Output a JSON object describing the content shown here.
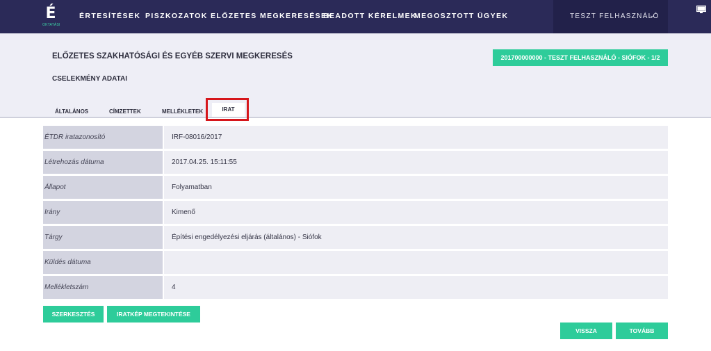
{
  "nav": {
    "logo_letter": "É",
    "logo_subtext": "OKTATÁSI",
    "items": [
      {
        "label": "Értesítések"
      },
      {
        "label": "Piszkozatok"
      },
      {
        "label": "Előzetes megkeresések"
      },
      {
        "label": "Beadott kérelmek"
      },
      {
        "label": "Megosztott ügyek"
      }
    ],
    "user_label": "TESZT FELHASZNÁLÓ",
    "user_caret": "⌄"
  },
  "header": {
    "title": "ELŐZETES SZAKHATÓSÁGI ÉS EGYÉB SZERVI MEGKERESÉS",
    "section": "CSELEKMÉNY ADATAI",
    "badge": "201700000000 - TESZT FELHASZNÁLÓ - SIÓFOK - 1/2"
  },
  "tabs": [
    {
      "label": "ÁLTALÁNOS"
    },
    {
      "label": "CÍMZETTEK"
    },
    {
      "label": "MELLÉKLETEK"
    },
    {
      "label": "IRAT"
    }
  ],
  "active_tab": "IRAT",
  "rows": [
    {
      "label": "ÉTDR iratazonosító",
      "value": "IRF-08016/2017"
    },
    {
      "label": "Létrehozás dátuma",
      "value": "2017.04.25. 15:11:55"
    },
    {
      "label": "Állapot",
      "value": "Folyamatban"
    },
    {
      "label": "Irány",
      "value": "Kimenő"
    },
    {
      "label": "Tárgy",
      "value": "Építési engedélyezési eljárás (általános) - Siófok"
    },
    {
      "label": "Küldés dátuma",
      "value": ""
    },
    {
      "label": "Mellékletszám",
      "value": "4"
    }
  ],
  "buttons": {
    "edit": "SZERKESZTÉS",
    "view_image": "IRATKÉP MEGTEKINTÉSE",
    "back": "VISSZA",
    "next": "TOVÁBB"
  },
  "colors": {
    "navbar": "#2b2a58",
    "accent": "#2ecc9a",
    "highlight": "#d6161b"
  }
}
